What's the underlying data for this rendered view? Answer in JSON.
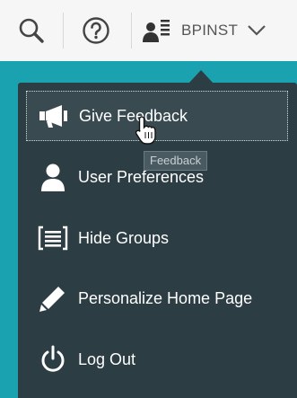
{
  "header": {
    "search_icon": "search-icon",
    "help_icon": "help-circle-icon",
    "user_icon": "user-list-icon",
    "user_name": "BPINST",
    "chevron_icon": "chevron-down-icon"
  },
  "menu": {
    "items": [
      {
        "label": "Give Feedback",
        "icon": "megaphone-icon",
        "focused": true
      },
      {
        "label": "User Preferences",
        "icon": "user-icon",
        "focused": false
      },
      {
        "label": "Hide Groups",
        "icon": "groups-icon",
        "focused": false
      },
      {
        "label": "Personalize Home Page",
        "icon": "pencil-icon",
        "focused": false
      },
      {
        "label": "Log Out",
        "icon": "power-icon",
        "focused": false
      }
    ]
  },
  "tooltip": {
    "text": "Feedback"
  },
  "colors": {
    "header_bg": "#f6f6f6",
    "accent_teal": "#1aa2b1",
    "menu_bg": "#2d3d44",
    "menu_text": "#ffffff"
  }
}
